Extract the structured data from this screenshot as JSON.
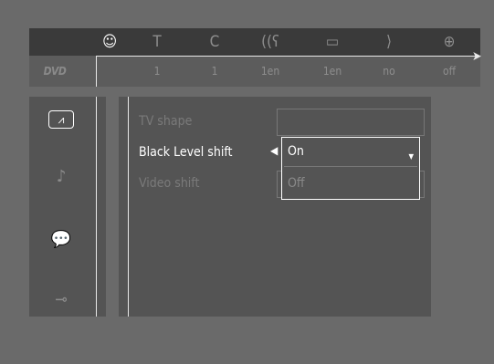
{
  "top_menu": {
    "icons": [
      {
        "name": "user-preferences-icon",
        "glyph": "☺",
        "active": true
      },
      {
        "name": "title-icon",
        "glyph": "T",
        "active": false
      },
      {
        "name": "chapter-icon",
        "glyph": "C",
        "active": false
      },
      {
        "name": "audio-language-icon",
        "glyph": "((ʕ",
        "active": false
      },
      {
        "name": "subtitle-icon",
        "glyph": "▭",
        "active": false
      },
      {
        "name": "angle-icon",
        "glyph": "⟩",
        "active": false
      },
      {
        "name": "zoom-icon",
        "glyph": "⊕",
        "active": false
      }
    ],
    "values": [
      "1",
      "1",
      "1en",
      "1en",
      "no",
      "off"
    ],
    "logo": "DVD"
  },
  "left_menu": {
    "icons": [
      {
        "name": "picture-icon",
        "glyph": "⩘",
        "active": true
      },
      {
        "name": "sound-icon",
        "glyph": "♪",
        "active": false
      },
      {
        "name": "language-icon",
        "glyph": "💬",
        "active": false
      },
      {
        "name": "features-icon",
        "glyph": "⊸",
        "active": false
      }
    ]
  },
  "settings": {
    "rows": [
      {
        "label": "TV shape",
        "active": false
      },
      {
        "label": "Black Level shift",
        "active": true
      },
      {
        "label": "Video shift",
        "active": false
      }
    ],
    "dropdown": {
      "options": [
        {
          "label": "On",
          "selected": true
        },
        {
          "label": "Off",
          "selected": false
        }
      ]
    }
  },
  "colors": {
    "background": "#6a6a6a",
    "panel": "#545454",
    "highlight": "#ffffff",
    "dim_text": "#7a7a7a"
  }
}
